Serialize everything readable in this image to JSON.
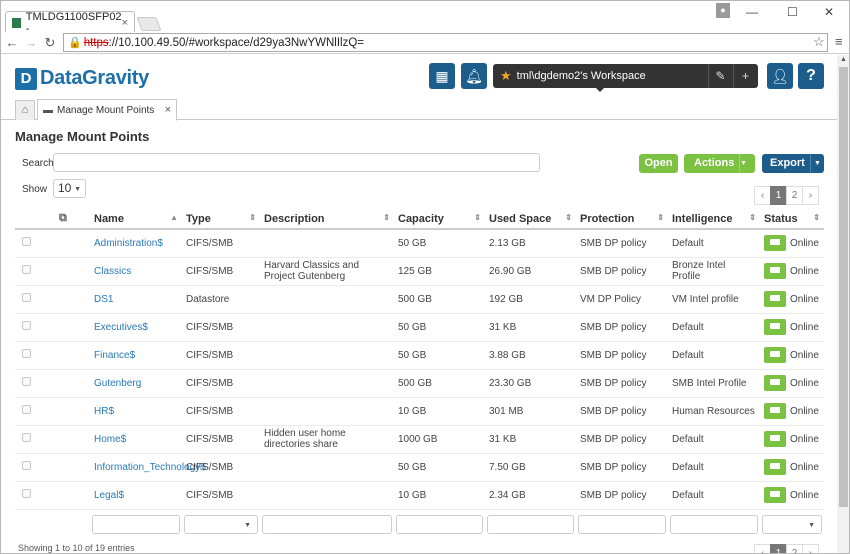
{
  "browser": {
    "tab_title": "TMLDG1100SFP02 -",
    "tab_close": "×",
    "profile_icon": "person-icon",
    "url_scheme": "https",
    "url_rest": "://10.100.49.50/#workspace/d29ya3NwYWNlIlzQ="
  },
  "header": {
    "logo_text": "DataGravity",
    "workspace_label": "tml\\dgdemo2's Workspace",
    "brand_color": "#1d6fa8",
    "accent_green": "#7cc242"
  },
  "app_tabs": {
    "home_icon": "home-icon",
    "active_tab": "Manage Mount Points",
    "close": "×"
  },
  "page": {
    "title": "Manage Mount Points",
    "search_label": "Search",
    "show_label": "Show",
    "show_value": "10",
    "open_button": "Open",
    "actions_button": "Actions",
    "export_button": "Export",
    "pagination": {
      "prev": "‹",
      "current": "1",
      "next_page": "2",
      "next": "›"
    },
    "footer": "Showing 1 to 10 of 19 entries"
  },
  "table": {
    "columns": [
      "Name",
      "Type",
      "Description",
      "Capacity",
      "Used Space",
      "Protection",
      "Intelligence",
      "Status"
    ],
    "rows": [
      {
        "name": "Administration$",
        "type": "CIFS/SMB",
        "description": "",
        "capacity": "50 GB",
        "used": "2.13 GB",
        "protection": "SMB DP policy",
        "intelligence": "Default",
        "status": "Online"
      },
      {
        "name": "Classics",
        "type": "CIFS/SMB",
        "description": "Harvard Classics and Project Gutenberg",
        "capacity": "125 GB",
        "used": "26.90 GB",
        "protection": "SMB DP policy",
        "intelligence": "Bronze Intel Profile",
        "status": "Online"
      },
      {
        "name": "DS1",
        "type": "Datastore",
        "description": "",
        "capacity": "500 GB",
        "used": "192 GB",
        "protection": "VM DP Policy",
        "intelligence": "VM Intel profile",
        "status": "Online"
      },
      {
        "name": "Executives$",
        "type": "CIFS/SMB",
        "description": "",
        "capacity": "50 GB",
        "used": "31 KB",
        "protection": "SMB DP policy",
        "intelligence": "Default",
        "status": "Online"
      },
      {
        "name": "Finance$",
        "type": "CIFS/SMB",
        "description": "",
        "capacity": "50 GB",
        "used": "3.88 GB",
        "protection": "SMB DP policy",
        "intelligence": "Default",
        "status": "Online"
      },
      {
        "name": "Gutenberg",
        "type": "CIFS/SMB",
        "description": "",
        "capacity": "500 GB",
        "used": "23.30 GB",
        "protection": "SMB DP policy",
        "intelligence": "SMB Intel Profile",
        "status": "Online"
      },
      {
        "name": "HR$",
        "type": "CIFS/SMB",
        "description": "",
        "capacity": "10 GB",
        "used": "301 MB",
        "protection": "SMB DP policy",
        "intelligence": "Human Resources",
        "status": "Online"
      },
      {
        "name": "Home$",
        "type": "CIFS/SMB",
        "description": "Hidden user home directories share",
        "capacity": "1000 GB",
        "used": "31 KB",
        "protection": "SMB DP policy",
        "intelligence": "Default",
        "status": "Online"
      },
      {
        "name": "Information_Technology$",
        "type": "CIFS/SMB",
        "description": "",
        "capacity": "50 GB",
        "used": "7.50 GB",
        "protection": "SMB DP policy",
        "intelligence": "Default",
        "status": "Online"
      },
      {
        "name": "Legal$",
        "type": "CIFS/SMB",
        "description": "",
        "capacity": "10 GB",
        "used": "2.34 GB",
        "protection": "SMB DP policy",
        "intelligence": "Default",
        "status": "Online"
      }
    ]
  }
}
